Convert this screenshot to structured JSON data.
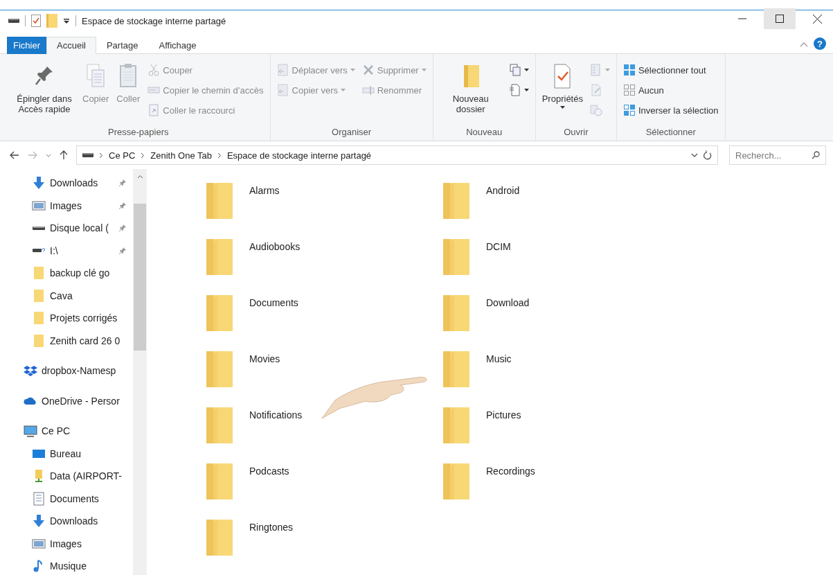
{
  "title_bar": {
    "title": "Espace de stockage interne partagé"
  },
  "ribbon_tabs": [
    {
      "label": "Fichier",
      "kind": "file",
      "selected": false
    },
    {
      "label": "Accueil",
      "kind": "tab",
      "selected": true
    },
    {
      "label": "Partage",
      "kind": "tab",
      "selected": false
    },
    {
      "label": "Affichage",
      "kind": "tab",
      "selected": false
    }
  ],
  "help": "?",
  "ribbon": {
    "groups": [
      {
        "label": "Presse-papiers",
        "columns": [
          {
            "kind": "large",
            "commands": [
              {
                "label": "Épingler dans Accès rapide",
                "kind": "pin",
                "disabled": false,
                "dropdown": false
              }
            ]
          },
          {
            "kind": "large",
            "commands": [
              {
                "label": "Copier",
                "kind": "copy",
                "disabled": true,
                "dropdown": false
              }
            ]
          },
          {
            "kind": "large",
            "commands": [
              {
                "label": "Coller",
                "kind": "paste",
                "disabled": true,
                "dropdown": false
              }
            ]
          },
          {
            "kind": "small",
            "commands": [
              {
                "label": "Couper",
                "kind": "cut",
                "disabled": true,
                "dropdown": false
              },
              {
                "label": "Copier le chemin d’accès",
                "kind": "path",
                "disabled": true,
                "dropdown": false
              },
              {
                "label": "Coller le raccourci",
                "kind": "shortcut",
                "disabled": true,
                "dropdown": false
              }
            ]
          }
        ]
      },
      {
        "label": "Organiser",
        "columns": [
          {
            "kind": "small",
            "commands": [
              {
                "label": "Déplacer vers",
                "kind": "move",
                "disabled": true,
                "dropdown": true
              },
              {
                "label": "Copier vers",
                "kind": "copyto",
                "disabled": true,
                "dropdown": true
              }
            ]
          },
          {
            "kind": "small",
            "commands": [
              {
                "label": "Supprimer",
                "kind": "delete",
                "disabled": true,
                "dropdown": true
              },
              {
                "label": "Renommer",
                "kind": "rename",
                "disabled": true,
                "dropdown": false
              }
            ]
          }
        ]
      },
      {
        "label": "Nouveau",
        "columns": [
          {
            "kind": "large",
            "commands": [
              {
                "label": "Nouveau dossier",
                "kind": "newfolder",
                "disabled": false,
                "dropdown": false
              }
            ]
          },
          {
            "kind": "small",
            "commands": [
              {
                "kind": "newitem",
                "disabled": false,
                "dropdown": true
              },
              {
                "kind": "easyaccess",
                "disabled": false,
                "dropdown": true
              }
            ]
          }
        ]
      },
      {
        "label": "Ouvrir",
        "columns": [
          {
            "kind": "large",
            "commands": [
              {
                "label": "Propriétés",
                "kind": "properties",
                "disabled": false,
                "dropdown": true
              }
            ]
          },
          {
            "kind": "small",
            "commands": [
              {
                "kind": "open",
                "disabled": true,
                "dropdown": true
              },
              {
                "kind": "edit",
                "disabled": true,
                "dropdown": false
              },
              {
                "kind": "history",
                "disabled": true,
                "dropdown": false
              }
            ]
          }
        ]
      },
      {
        "label": "Sélectionner",
        "columns": [
          {
            "kind": "small",
            "commands": [
              {
                "label": "Sélectionner tout",
                "kind": "selectall",
                "disabled": false,
                "dropdown": false
              },
              {
                "label": "Aucun",
                "kind": "selectnone",
                "disabled": false,
                "dropdown": false
              },
              {
                "label": "Inverser la sélection",
                "kind": "invert",
                "disabled": false,
                "dropdown": false
              }
            ]
          }
        ]
      }
    ]
  },
  "address_bar": {
    "breadcrumbs": [
      "Ce PC",
      "Zenith One Tab",
      "Espace de stockage interne partagé"
    ],
    "search": {
      "placeholder": "Recherch..."
    }
  },
  "sidebar": {
    "quick_access_items": [
      {
        "label": "Downloads",
        "kind": "download",
        "pinned": true
      },
      {
        "label": "Images",
        "kind": "images",
        "pinned": true
      },
      {
        "label": "Disque local (",
        "kind": "drive",
        "pinned": true
      },
      {
        "label": "I:\\",
        "kind": "unknown-drive",
        "pinned": true
      },
      {
        "label": "backup clé go",
        "kind": "folder",
        "pinned": false
      },
      {
        "label": "Cava",
        "kind": "folder",
        "pinned": false
      },
      {
        "label": "Projets corrigés",
        "kind": "folder",
        "pinned": false
      },
      {
        "label": "Zenith card 26 0",
        "kind": "folder",
        "pinned": false
      }
    ],
    "items": [
      {
        "label": "dropbox-Namesp",
        "kind": "dropbox"
      },
      {
        "label": "OneDrive - Persor",
        "kind": "onedrive"
      },
      {
        "label": "Ce PC",
        "kind": "pc",
        "children": [
          {
            "label": "Bureau",
            "kind": "desktop"
          },
          {
            "label": "Data (AIRPORT-",
            "kind": "network"
          },
          {
            "label": "Documents",
            "kind": "documents"
          },
          {
            "label": "Downloads",
            "kind": "download"
          },
          {
            "label": "Images",
            "kind": "images"
          },
          {
            "label": "Musique",
            "kind": "music"
          }
        ]
      }
    ]
  },
  "folders": [
    "Alarms",
    "Android",
    "Audiobooks",
    "DCIM",
    "Documents",
    "Download",
    "Movies",
    "Music",
    "Notifications",
    "Pictures",
    "Podcasts",
    "Recordings",
    "Ringtones"
  ]
}
